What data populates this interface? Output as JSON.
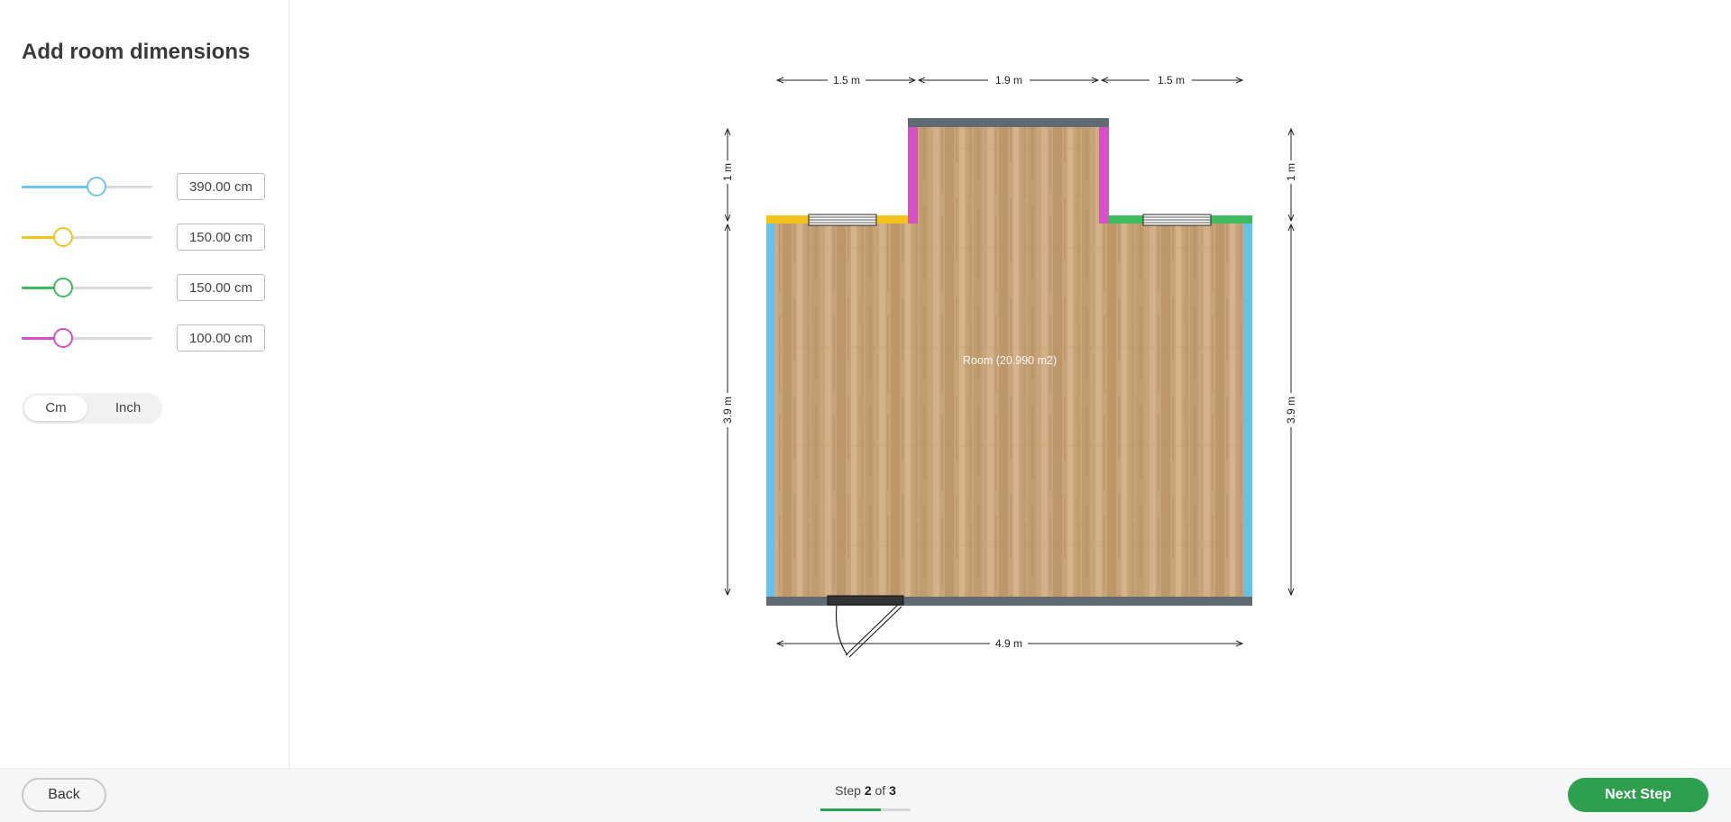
{
  "sidebar": {
    "title": "Add room dimensions",
    "dimensions": [
      {
        "value": "390.00 cm",
        "color": "#6cc6ea",
        "level": 0.57
      },
      {
        "value": "150.00 cm",
        "color": "#f3c31c",
        "level": 0.32
      },
      {
        "value": "150.00 cm",
        "color": "#3dbb5e",
        "level": 0.32
      },
      {
        "value": "100.00 cm",
        "color": "#d94fc8",
        "level": 0.32
      }
    ],
    "units": {
      "cm": "Cm",
      "inch": "Inch",
      "selected": "Cm"
    }
  },
  "plan": {
    "room_label": "Room (20.990 m2)",
    "top_dims": [
      "1.5 m",
      "1.9 m",
      "1.5 m"
    ],
    "bottom_dim": "4.9 m",
    "left_dims": [
      "1 m",
      "3.9 m"
    ],
    "right_dims": [
      "1 m",
      "3.9 m"
    ],
    "wall_colors": {
      "left": "#67c2e6",
      "right": "#67c2e6",
      "top_left": "#f3c31c",
      "top_right": "#3dbb5e",
      "alcove_sides": "#d94fc8",
      "alcove_top": "#5f6a72",
      "bottom": "#5f6a72"
    }
  },
  "footer": {
    "back_label": "Back",
    "step_prefix": "Step",
    "step_current": "2",
    "step_of": "of",
    "step_total": "3",
    "progress": 0.67,
    "next_label": "Next Step"
  }
}
